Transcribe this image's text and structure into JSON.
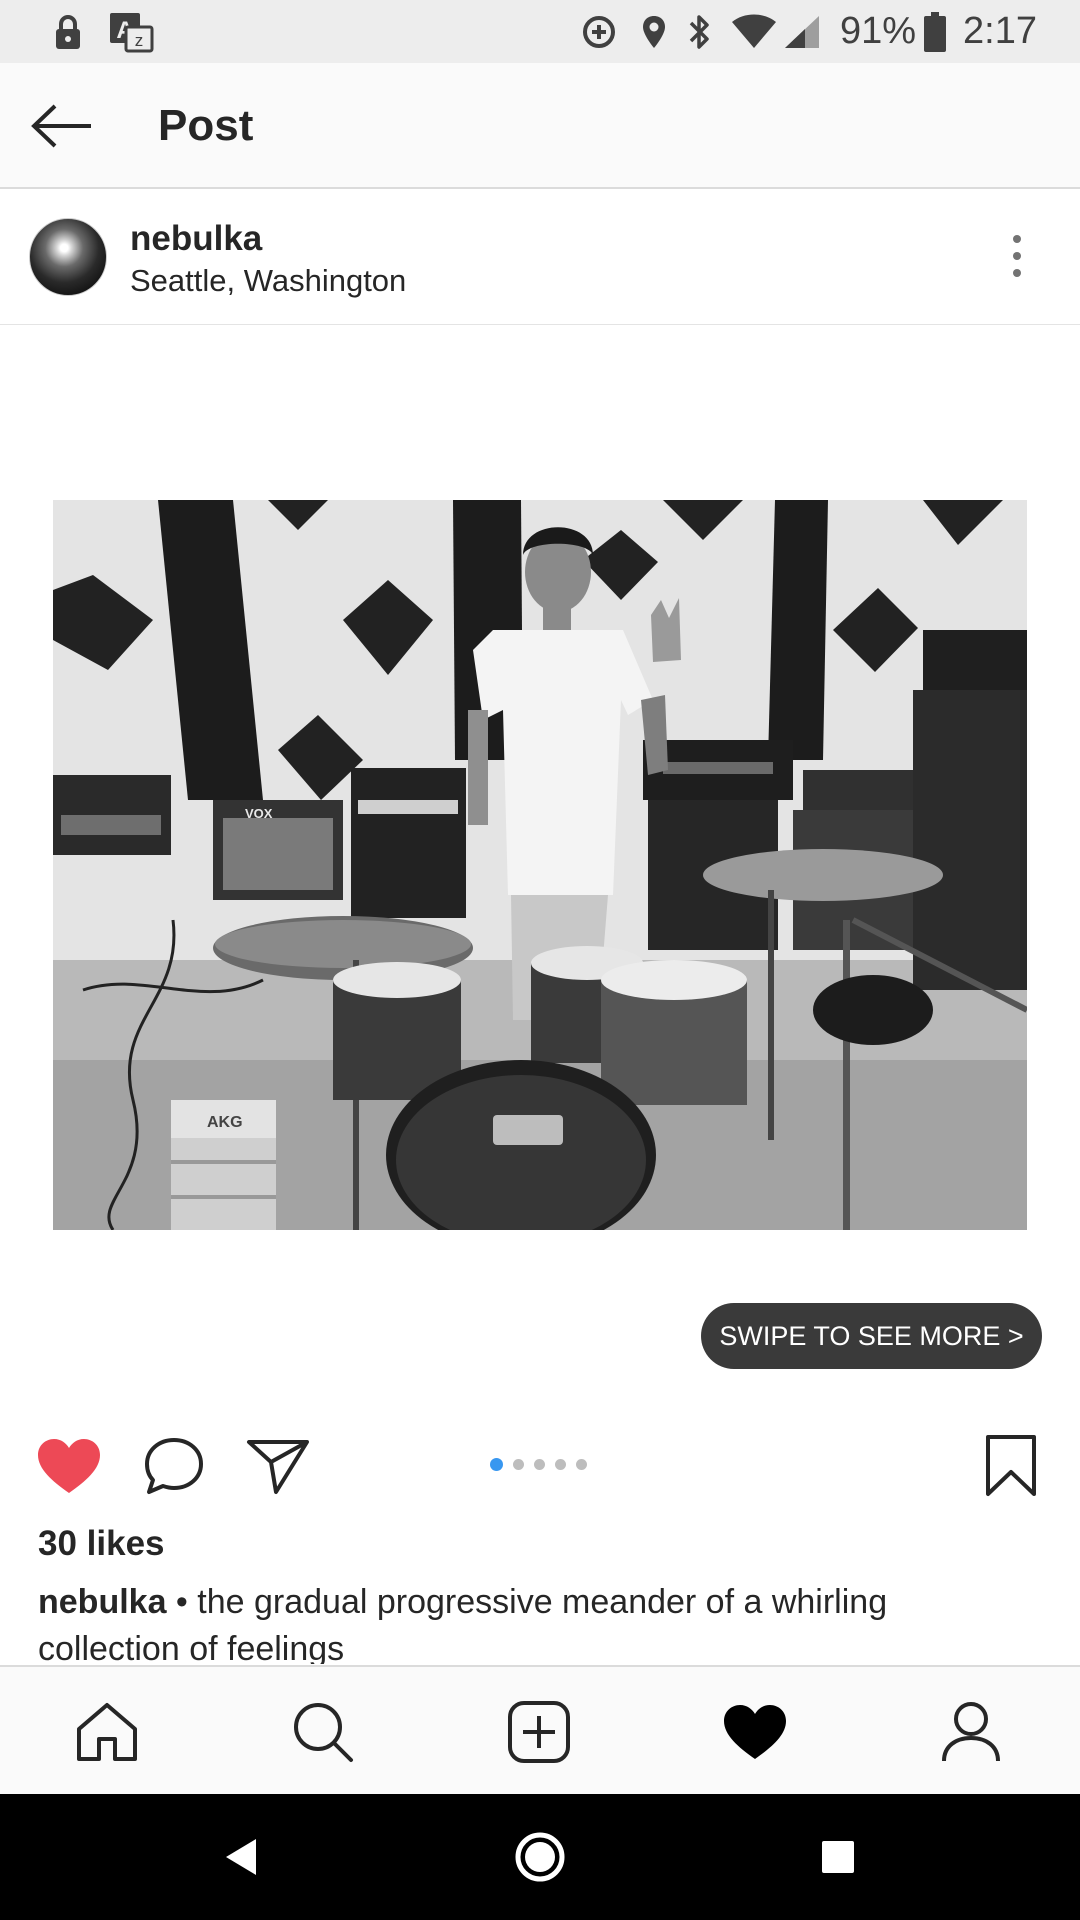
{
  "status_bar": {
    "icons": [
      "lock-icon",
      "translate-icon",
      "data-saver-icon",
      "location-icon",
      "bluetooth-icon",
      "wifi-icon",
      "signal-icon",
      "battery-icon"
    ],
    "battery": "91%",
    "time": "2:17"
  },
  "header": {
    "back_icon": "arrow-left-icon",
    "title": "Post"
  },
  "post": {
    "username": "nebulka",
    "location": "Seattle, Washington",
    "more_icon": "more-vertical-icon",
    "photo": {
      "vox_label": "VOX",
      "akg_label": "AKG"
    },
    "swipe_label": "SWIPE TO SEE MORE >",
    "carousel": {
      "count": 5,
      "active_index": 0
    },
    "like_icon": "heart-filled-icon",
    "comment_icon": "comment-icon",
    "share_icon": "send-icon",
    "save_icon": "bookmark-icon",
    "likes": "30 likes",
    "caption_user": "nebulka",
    "caption_text": " • the gradual progressive meander of a whirling collection of feelings"
  },
  "bottom_nav": [
    "home-icon",
    "search-icon",
    "add-post-icon",
    "activity-heart-icon",
    "profile-icon"
  ],
  "android_nav": [
    "back-triangle-icon",
    "home-circle-icon",
    "recents-square-icon"
  ],
  "colors": {
    "like_red": "#ed4956",
    "carousel_blue": "#3897f0",
    "status_bar_bg": "#ededed",
    "pill_bg": "#3a3a3a"
  }
}
